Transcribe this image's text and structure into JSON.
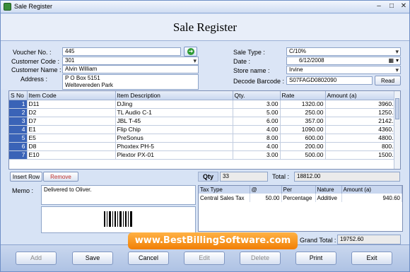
{
  "window": {
    "title": "Sale Register"
  },
  "heading": "Sale Register",
  "form": {
    "voucher_no_label": "Voucher No. :",
    "voucher_no": "445",
    "customer_code_label": "Customer Code :",
    "customer_code": "301",
    "customer_name_label": "Customer Name :",
    "customer_name": "Alvin William",
    "address_label": "Address :",
    "address_line1": "P O Box 5151",
    "address_line2": "Weltevereden Park",
    "sale_type_label": "Sale Type :",
    "sale_type": "C/10%",
    "date_label": "Date :",
    "date": "6/12/2008",
    "store_name_label": "Store name :",
    "store_name": "Irvine",
    "barcode_label": "Decode Barcode :",
    "barcode": "S07FAGD0802090",
    "read_label": "Read"
  },
  "items": {
    "columns": [
      "S No",
      "Item Code",
      "Item Description",
      "Qty.",
      "Rate",
      "Amount (a)"
    ],
    "rows": [
      [
        "1",
        "D11",
        "DJing",
        "3.00",
        "1320.00",
        "3960."
      ],
      [
        "2",
        "D2",
        "TL Audio C-1",
        "5.00",
        "250.00",
        "1250."
      ],
      [
        "3",
        "D7",
        "JBL T-45",
        "6.00",
        "357.00",
        "2142."
      ],
      [
        "4",
        "E1",
        "Flip Chip",
        "4.00",
        "1090.00",
        "4360."
      ],
      [
        "5",
        "E5",
        "PreSonus",
        "8.00",
        "600.00",
        "4800."
      ],
      [
        "6",
        "D8",
        "Phoxtex PH-5",
        "4.00",
        "200.00",
        "800."
      ],
      [
        "7",
        "E10",
        "Plextor PX-01",
        "3.00",
        "500.00",
        "1500."
      ]
    ]
  },
  "row_actions": {
    "insert_label": "Insert Row",
    "remove_label": "Remove"
  },
  "summary": {
    "qty_label": "Qty",
    "qty_value": "33",
    "total_label": "Total :",
    "total_value": "18812.00"
  },
  "memo": {
    "label": "Memo :",
    "value": "Delivered to Oliver."
  },
  "tax": {
    "columns": [
      "Tax Type",
      "@",
      "Per",
      "Nature",
      "Amount (a)"
    ],
    "rows": [
      [
        "Central Sales Tax",
        "50.00",
        "Percentage",
        "Additive",
        "940.60"
      ]
    ]
  },
  "grand_total": {
    "label": "Grand Total :",
    "value": "19752.60"
  },
  "banner": "www.BestBillingSoftware.com",
  "footer": {
    "add": "Add",
    "save": "Save",
    "cancel": "Cancel",
    "edit": "Edit",
    "delete": "Delete",
    "print": "Print",
    "exit": "Exit"
  }
}
